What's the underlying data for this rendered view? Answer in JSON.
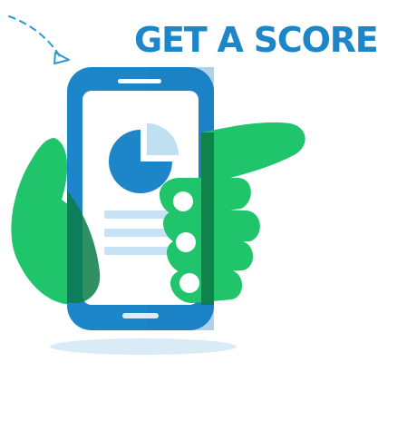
{
  "headline": "GET A SCORE",
  "colors": {
    "title": "#1d86c8",
    "phone_body": "#1d86c8",
    "screen": "#ffffff",
    "pie_main": "#1d86c8",
    "pie_slice": "#bfe0f0",
    "text_lines": "#c5e3f4",
    "hand": "#1fc46b",
    "hand_dark": "#0c7c47",
    "shadow": "#d9ecf6",
    "arrow": "#2a9ad4"
  },
  "icons": {
    "arrow": "curved-arrow-icon",
    "phone": "smartphone-icon",
    "chart": "pie-chart-icon",
    "hand": "hand-icon"
  }
}
